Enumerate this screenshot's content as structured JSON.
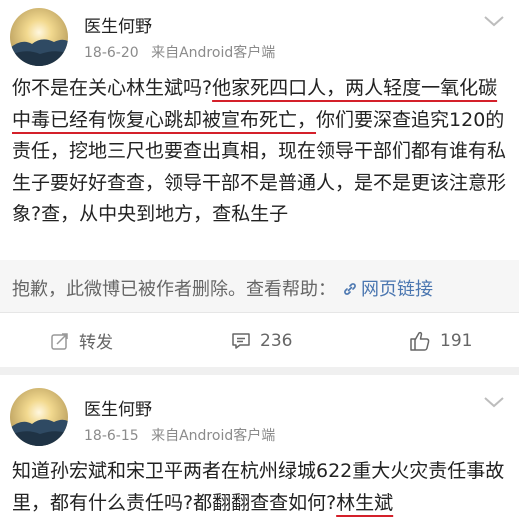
{
  "posts": [
    {
      "author": "医生何野",
      "date": "18-6-20",
      "source": "来自Android客户端",
      "text_segments": [
        {
          "text": "你不是在关心林生斌吗?",
          "underline": false
        },
        {
          "text": "他家死四口人，两人轻度一氧化碳中毒已经有恢复心跳却被宣布死亡，",
          "underline": true
        },
        {
          "text": "你们要深查追究120的责任，挖地三尺也要查出真相，现在领导干部们都有谁有私生子要好好查查，领导干部不是普通人，是不是更该注意形象?查，从中央到地方，查私生子",
          "underline": false
        }
      ],
      "deleted_notice": "抱歉，此微博已被作者删除。查看帮助：",
      "help_link": "网页链接",
      "repost_label": "转发",
      "comment_count": "236",
      "like_count": "191"
    },
    {
      "author": "医生何野",
      "date": "18-6-15",
      "source": "来自Android客户端",
      "text_segments": [
        {
          "text": "知道孙宏斌和宋卫平两者在杭州绿城622重大火灾责任事故里，都有什么责任吗?都翻翻查查如何?",
          "underline": false
        },
        {
          "text": "林生斌",
          "underline": true
        }
      ]
    }
  ],
  "colors": {
    "underline": "#d4202a",
    "link": "#4a76b0",
    "background": "#f0f0f0"
  },
  "icons": {
    "chevron": "chevron-down-icon",
    "link": "link-icon",
    "repost": "repost-icon",
    "comment": "comment-icon",
    "like": "thumbs-up-icon"
  }
}
